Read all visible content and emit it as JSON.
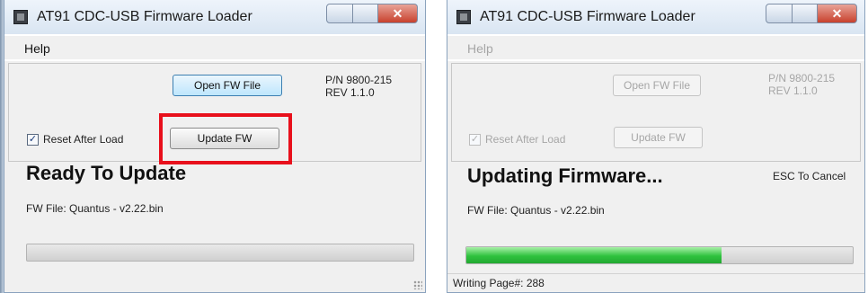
{
  "window1": {
    "title": "AT91 CDC-USB Firmware Loader",
    "menu": {
      "help": "Help"
    },
    "open_fw_button": "Open FW File",
    "pn_line1": "P/N 9800-215",
    "pn_line2": "REV 1.1.0",
    "reset_checkbox_label": "Reset After Load",
    "reset_checked": true,
    "update_fw_button": "Update FW",
    "status": "Ready To Update",
    "fw_file": "FW File: Quantus - v2.22.bin",
    "progress": 0
  },
  "window2": {
    "title": "AT91 CDC-USB Firmware Loader",
    "menu": {
      "help": "Help"
    },
    "open_fw_button": "Open FW File",
    "pn_line1": "P/N 9800-215",
    "pn_line2": "REV 1.1.0",
    "reset_checkbox_label": "Reset After Load",
    "reset_checked": true,
    "update_fw_button": "Update FW",
    "status": "Updating Firmware...",
    "esc_hint": "ESC To Cancel",
    "fw_file": "FW File: Quantus - v2.22.bin",
    "progress": 0.66,
    "statusbar_text": "Writing Page#: 288"
  },
  "colors": {
    "highlight": "#e8101c",
    "progress_green": "#2fc23e"
  },
  "icons": {
    "app": "chip-icon",
    "checkbox": "checkmark-icon"
  }
}
